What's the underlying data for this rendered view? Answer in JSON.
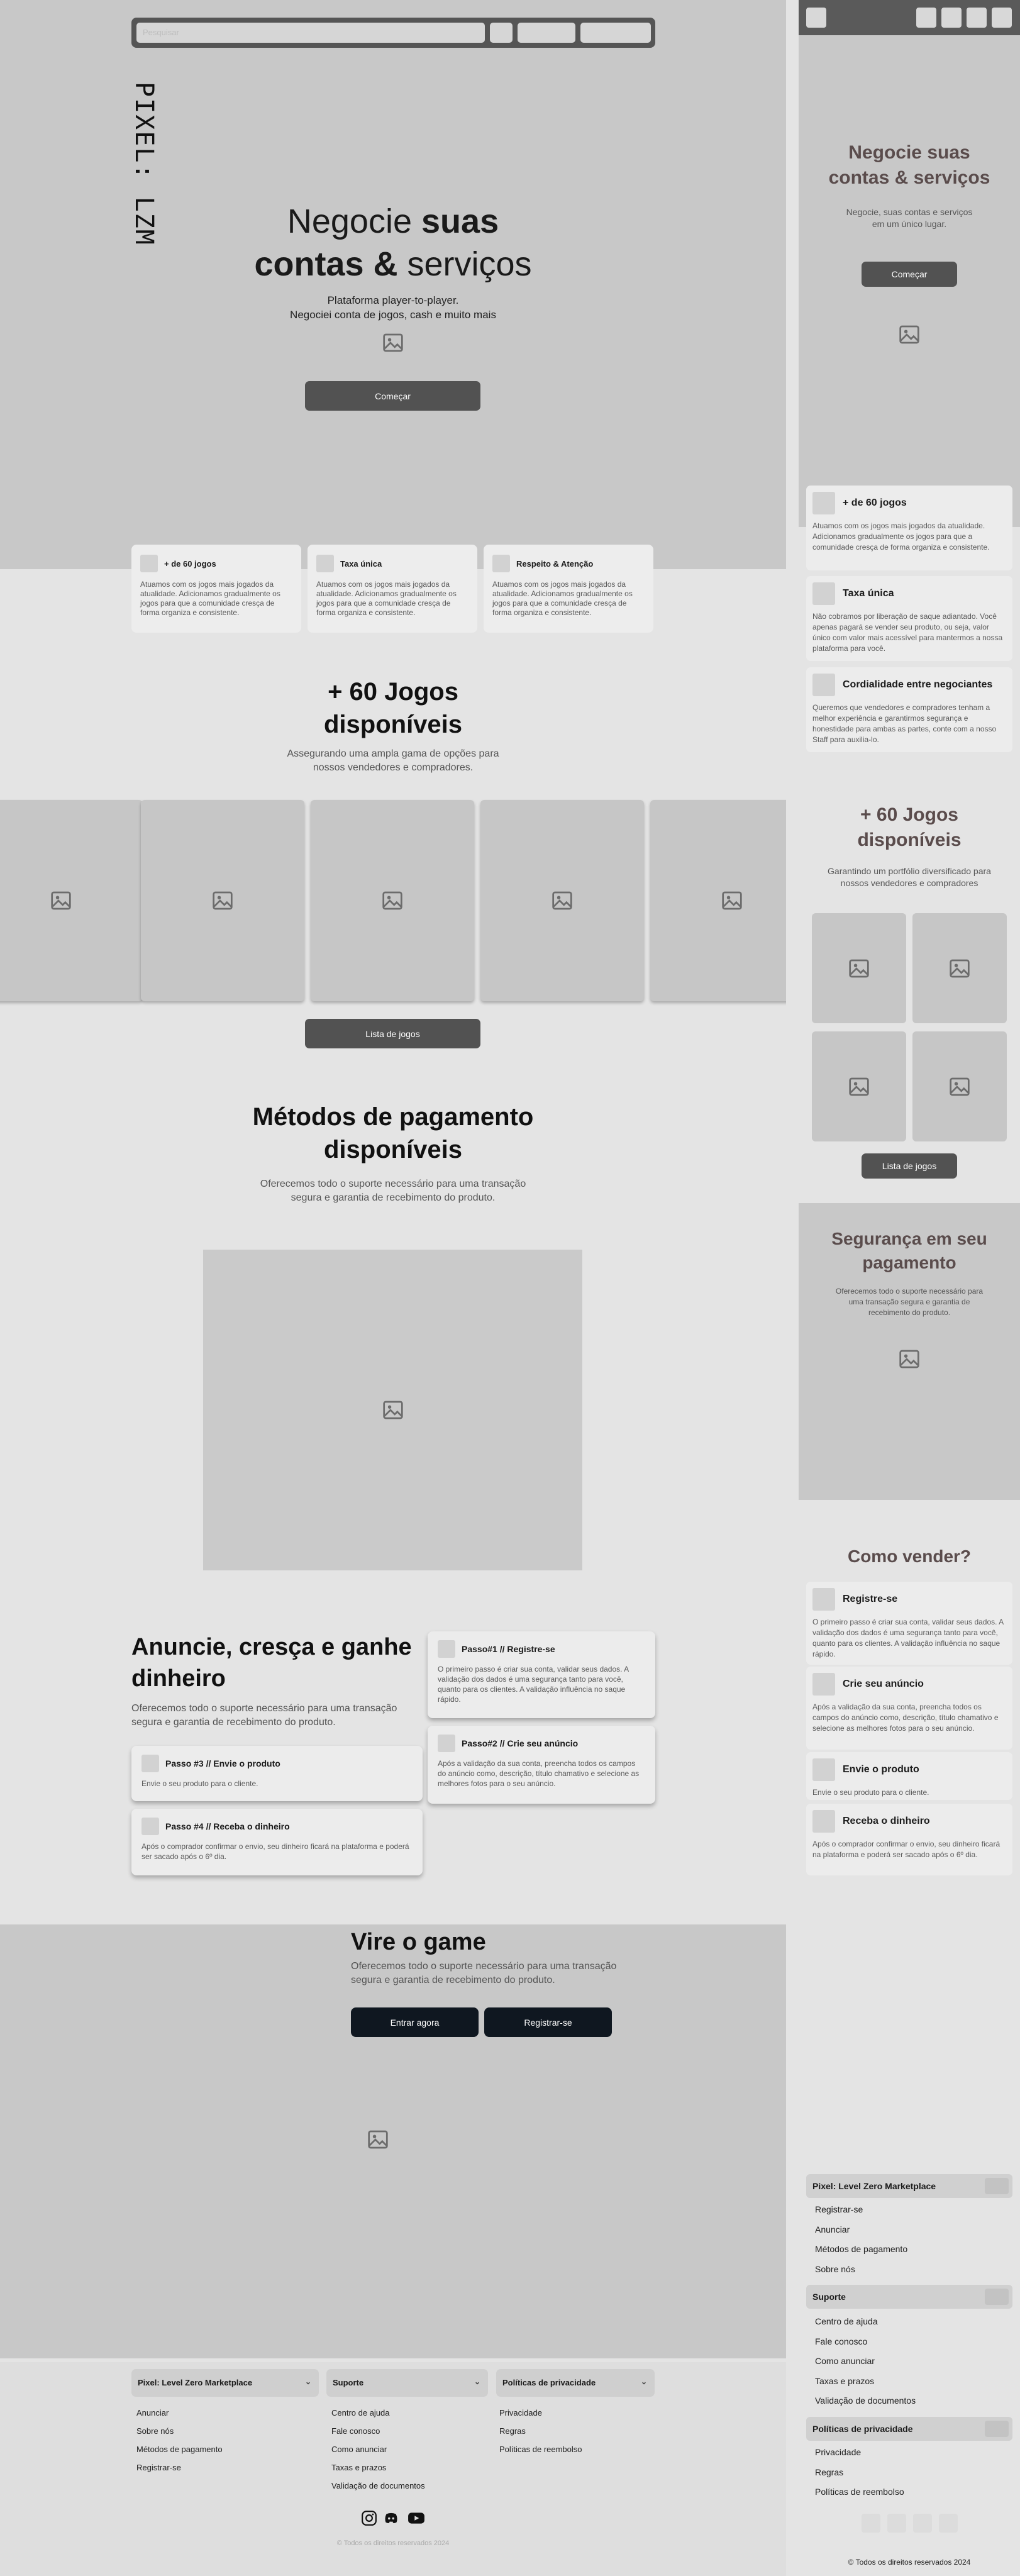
{
  "header": {
    "search_placeholder": "Pesquisar",
    "logo": "PIXEL: LZM"
  },
  "hero": {
    "title_pre": "Negocie ",
    "title_bold1": "suas",
    "title_bold2": "contas &",
    "title_post": " serviços",
    "subtitle_line1": "Plataforma player-to-player.",
    "subtitle_line2": "Negociei conta de jogos, cash e muito mais",
    "cta": "Começar"
  },
  "features": [
    {
      "title": "+ de 60 jogos",
      "desc": "Atuamos com os jogos mais jogados da atualidade. Adicionamos gradualmente os jogos para que a comunidade cresça de forma organiza e consistente."
    },
    {
      "title": "Taxa única",
      "desc": "Atuamos com os jogos mais jogados da atualidade. Adicionamos gradualmente os jogos para que a comunidade cresça de forma organiza e consistente."
    },
    {
      "title": "Respeito & Atenção",
      "desc": "Atuamos com os jogos mais jogados da atualidade. Adicionamos gradualmente os jogos para que a comunidade cresça de forma organiza e consistente."
    }
  ],
  "games": {
    "title_line1": "+ 60 Jogos",
    "title_line2": "disponíveis",
    "subtitle_line1": "Assegurando uma ampla gama de opções para",
    "subtitle_line2": "nossos vendedores e compradores.",
    "button": "Lista de jogos"
  },
  "payment": {
    "title_line1": "Métodos de pagamento",
    "title_line2": "disponíveis",
    "subtitle_line1": "Oferecemos todo o suporte necessário para uma transação",
    "subtitle_line2": "segura e garantia de recebimento do produto."
  },
  "sell": {
    "title_line1": "Anuncie, cresça e ganhe",
    "title_line2": "dinheiro",
    "subtitle_line1": "Oferecemos todo o suporte necessário para uma transação",
    "subtitle_line2": "segura e garantia de recebimento do produto.",
    "steps": [
      {
        "title": "Passo#1 // Registre-se",
        "desc": "O primeiro passo é criar sua conta, validar seus dados. A validação dos dados é uma segurança tanto para você, quanto para os clientes. A validação influência no saque rápido."
      },
      {
        "title": "Passo#2 // Crie seu anúncio",
        "desc": "Após a validação da sua conta, preencha todos os campos do anúncio como, descrição, título chamativo e selecione as melhores fotos para o seu anúncio."
      },
      {
        "title": "Passo #3 // Envie o produto",
        "desc": "Envie o seu produto para o cliente."
      },
      {
        "title": "Passo #4 // Receba o dinheiro",
        "desc": "Após o comprador confirmar o envio, seu dinheiro ficará na plataforma e poderá ser sacado após o 6º dia."
      }
    ]
  },
  "vire": {
    "title": "Vire o game",
    "subtitle_line1": "Oferecemos todo o suporte necessário para uma transação",
    "subtitle_line2": "segura e garantia de recebimento do produto.",
    "login": "Entrar agora",
    "register": "Registrar-se"
  },
  "footer": {
    "groups": [
      {
        "title": "Pixel: Level Zero Marketplace",
        "items": [
          "Anunciar",
          "Sobre nós",
          "Métodos de pagamento",
          "Registrar-se"
        ]
      },
      {
        "title": "Suporte",
        "items": [
          "Centro de ajuda",
          "Fale conosco",
          "Como anunciar",
          "Taxas e prazos",
          "Validação de documentos"
        ]
      },
      {
        "title": "Políticas de privacidade",
        "items": [
          "Privacidade",
          "Regras",
          "Políticas de reembolso"
        ]
      }
    ],
    "copyright": "© Todos os direitos reservados 2024"
  },
  "mobile": {
    "hero_title_line1": "Negocie suas",
    "hero_title_line2": "contas & serviços",
    "hero_sub_line1": "Negocie, suas contas e serviços",
    "hero_sub_line2": "em um único lugar.",
    "cta": "Começar",
    "features": [
      {
        "title": "+ de 60 jogos",
        "desc": "Atuamos com os jogos mais jogados da atualidade. Adicionamos gradualmente os jogos para que a comunidade cresça de forma organiza e consistente."
      },
      {
        "title": "Taxa única",
        "desc": "Não cobramos por liberação de saque adiantado. Você apenas pagará se vender seu produto, ou seja, valor único com valor mais acessível para mantermos a nossa plataforma para você."
      },
      {
        "title": "Cordialidade entre negociantes",
        "desc": "Queremos que vendedores e compradores tenham a melhor experiência e garantirmos segurança e honestidade para ambas as partes, conte com a nosso Staff para auxilia-lo."
      }
    ],
    "games_title_line1": "+ 60 Jogos",
    "games_title_line2": "disponíveis",
    "games_sub_line1": "Garantindo um portfólio diversificado para",
    "games_sub_line2": "nossos vendedores e compradores",
    "games_button": "Lista de jogos",
    "security_title_line1": "Segurança em seu",
    "security_title_line2": "pagamento",
    "security_sub": "Oferecemos todo o suporte necessário para uma transação segura e garantia de recebimento do produto.",
    "how_title": "Como vender?",
    "steps": [
      {
        "title": "Registre-se",
        "desc": "O primeiro passo é criar sua conta, validar seus dados. A validação dos dados é uma segurança tanto para você, quanto para os clientes. A validação influência no saque rápido."
      },
      {
        "title": "Crie seu anúncio",
        "desc": "Após a validação da sua conta, preencha todos os campos do anúncio como, descrição, título chamativo e selecione as melhores fotos para o seu anúncio."
      },
      {
        "title": "Envie o produto",
        "desc": "Envie o seu produto para o cliente."
      },
      {
        "title": "Receba o dinheiro",
        "desc": "Após o comprador confirmar o envio, seu dinheiro ficará na plataforma e poderá ser sacado após o 6º dia."
      }
    ],
    "copyright": "© Todos os direitos reservados 2024"
  },
  "colors": {
    "hero_bg": "#c8c8c8",
    "page_bg": "#e4e4e4",
    "button_dark": "#525252",
    "button_navy": "#0f1720",
    "mobile_title": "#5a4c4c"
  }
}
